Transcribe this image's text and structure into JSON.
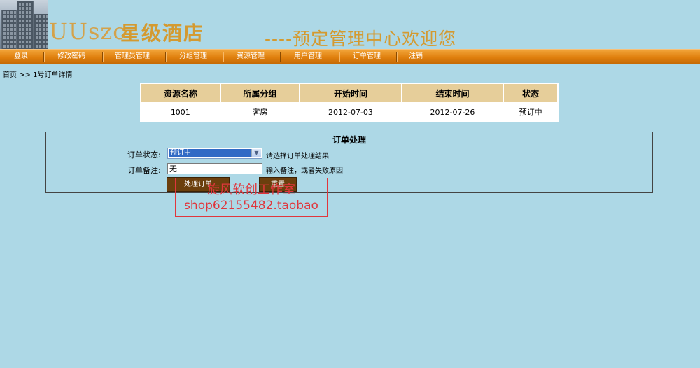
{
  "header": {
    "brand_en": "UUszc",
    "brand_cn": "星级酒店",
    "welcome": "----预定管理中心欢迎您"
  },
  "nav": {
    "items": [
      "登录",
      "修改密码",
      "管理员管理",
      "分组管理",
      "资源管理",
      "用户管理",
      "订单管理",
      "注销"
    ]
  },
  "breadcrumb": "首页 >> 1号订单详情",
  "detail_table": {
    "headers": [
      "资源名称",
      "所属分组",
      "开始时间",
      "结束时间",
      "状态"
    ],
    "row": [
      "1001",
      "客房",
      "2012-07-03",
      "2012-07-26",
      "预订中"
    ]
  },
  "order_form": {
    "title": "订单处理",
    "status_label": "订单状态:",
    "status_value": "预订中",
    "status_hint": "请选择订单处理结果",
    "remark_label": "订单备注:",
    "remark_value": "无",
    "remark_hint": "输入备注，或者失败原因",
    "submit_label": "处理订单",
    "reset_label": "重置"
  },
  "watermark": {
    "line1": "旋风软创工作室",
    "line2": "shop62155482.taobao"
  },
  "colors": {
    "background": "#ADD8E6",
    "nav_orange": "#E0800E",
    "brand_gold": "#D49A30",
    "table_header": "#E6CE9A",
    "button_brown": "#6B3F0D",
    "watermark_red": "#E0363C"
  }
}
